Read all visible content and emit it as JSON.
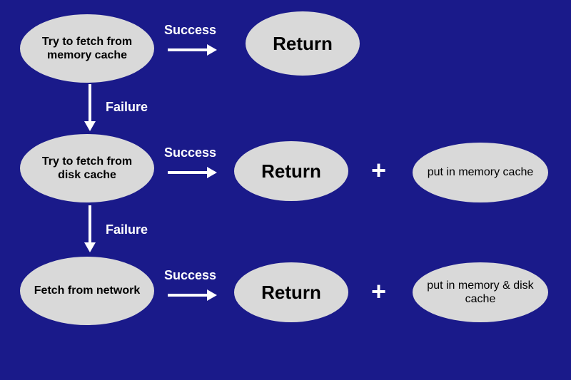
{
  "colors": {
    "background": "#1a1a8a",
    "node_fill": "#d9d9d9",
    "line": "#ffffff",
    "text_on_bg": "#ffffff",
    "text_on_node": "#000000"
  },
  "flow": {
    "step1": {
      "action": "Try to fetch from memory cache",
      "success_label": "Success",
      "failure_label": "Failure",
      "on_success": "Return"
    },
    "step2": {
      "action": "Try to fetch from disk cache",
      "success_label": "Success",
      "failure_label": "Failure",
      "on_success": "Return",
      "plus": "+",
      "side_effect": "put in memory cache"
    },
    "step3": {
      "action": "Fetch from network",
      "success_label": "Success",
      "on_success": "Return",
      "plus": "+",
      "side_effect": "put in memory & disk cache"
    }
  }
}
